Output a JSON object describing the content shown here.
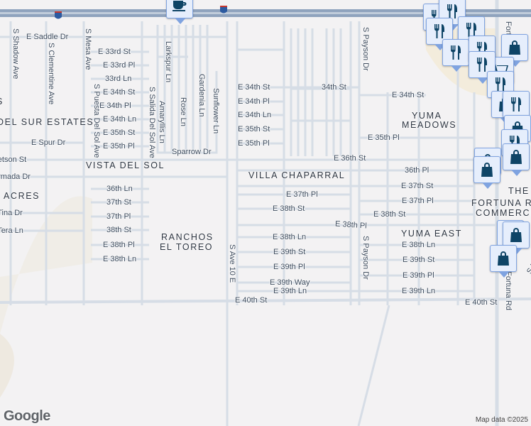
{
  "map": {
    "streets_h": [
      "E Saddle Dr",
      "E 33rd St",
      "E 33rd Pl",
      "33rd Ln",
      "E 34th St",
      "E 34th Pl",
      "E 34th Ln",
      "E 35th St",
      "E 35th Pl",
      "E Spur Dr",
      "E Stetson St",
      "E Armada Dr",
      "36th Ln",
      "37th St",
      "37th Pl",
      "38th St",
      "E 38th Pl",
      "E 38th Ln",
      "E Tina Dr",
      "E Tera Ln",
      "Sparrow Dr",
      "E 34th St",
      "34th St",
      "E 34th Pl",
      "E 34th Ln",
      "E 35th St",
      "E 35th Pl",
      "E 34th St",
      "E 35th Pl",
      "E 36th St",
      "36th Pl",
      "E 37th St",
      "E 37th Pl",
      "E 37th Pl",
      "E 38th St",
      "E 38th St",
      "E 38th Pl",
      "E 38th Ln",
      "E 38th Ln",
      "E 39th St",
      "E 39th St",
      "E 39th Pl",
      "E 39th Pl",
      "E 39th Way",
      "E 39th Ln",
      "E 39th Ln",
      "E 40th St",
      "E 40th St"
    ],
    "streets_v": [
      "S Shadow Ave",
      "S Clementine Ave",
      "S Mesa Ave",
      "S Puesta Del Sol Ave",
      "S Salida Del Sol Ave",
      "Larkspur Ln",
      "Amaryllis Ln",
      "Rose Ln",
      "Gardenia Ln",
      "Sunflower Ln",
      "S Ave 10 E",
      "S Payson Dr",
      "S Payson Dr",
      "Fortuna Rd",
      "S Mesa Ave",
      "Fortuna Rd"
    ],
    "neighborhoods": [
      "DEL SUR ESTATES",
      "VISTA DEL SOL",
      "ACRES",
      "RANCHOS",
      "EL TOREO",
      "VILLA CHAPARRAL",
      "YUMA",
      "MEADOWS",
      "YUMA EAST",
      "THE",
      "FORTUNA ROAD",
      "COMMERCIAL",
      "S"
    ],
    "highway_shield": "8",
    "poi_icons": [
      "cafe-icon",
      "restaurant-icon",
      "shopping-bag-icon",
      "shopping-cart-icon"
    ]
  },
  "attribution": "Map data ©2025",
  "logo": "Google",
  "colors": {
    "background": "#f3f2f3",
    "road": "#d6dde6",
    "highway": "#8fa3bd",
    "marker": "#0e4466",
    "commercial": "#f3ecdc"
  }
}
